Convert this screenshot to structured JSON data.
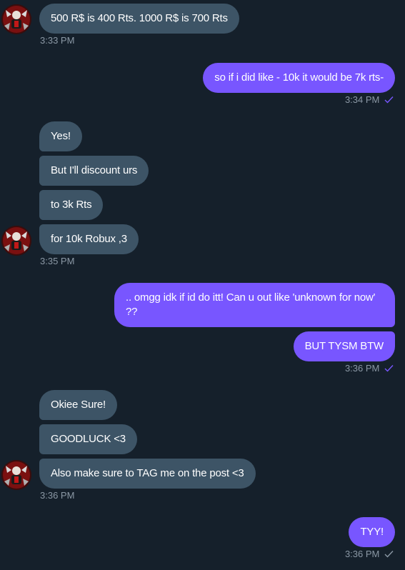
{
  "colors": {
    "background": "#15202b",
    "incoming_bubble": "#3d5466",
    "outgoing_bubble": "#7856ff",
    "timestamp": "#8b98a5",
    "read_check": "#7856ff",
    "sent_check": "#8b98a5"
  },
  "messages": {
    "g1": {
      "m1": "500 R$ is 400 Rts. 1000 R$ is 700 Rts",
      "time": "3:33 PM"
    },
    "g2": {
      "m1": "so if i did like - 10k it would be 7k rts-",
      "time": "3:34 PM",
      "status_icon": "double-check-icon"
    },
    "g3": {
      "m1": "Yes!",
      "m2": "But I'll discount urs",
      "m3": "to 3k Rts",
      "m4": "for 10k Robux ,3",
      "time": "3:35 PM"
    },
    "g4": {
      "m1": ".. omgg idk if id do itt! Can u out like 'unknown for now' ??",
      "m2": "BUT TYSM BTW",
      "time": "3:36 PM",
      "status_icon": "double-check-icon"
    },
    "g5": {
      "m1": "Okiee Sure!",
      "m2": "GOODLUCK <3",
      "m3": "Also make sure to TAG me on the post <3",
      "time": "3:36 PM"
    },
    "g6": {
      "m1": "TYY!",
      "time": "3:36 PM",
      "status_icon": "check-icon"
    }
  }
}
